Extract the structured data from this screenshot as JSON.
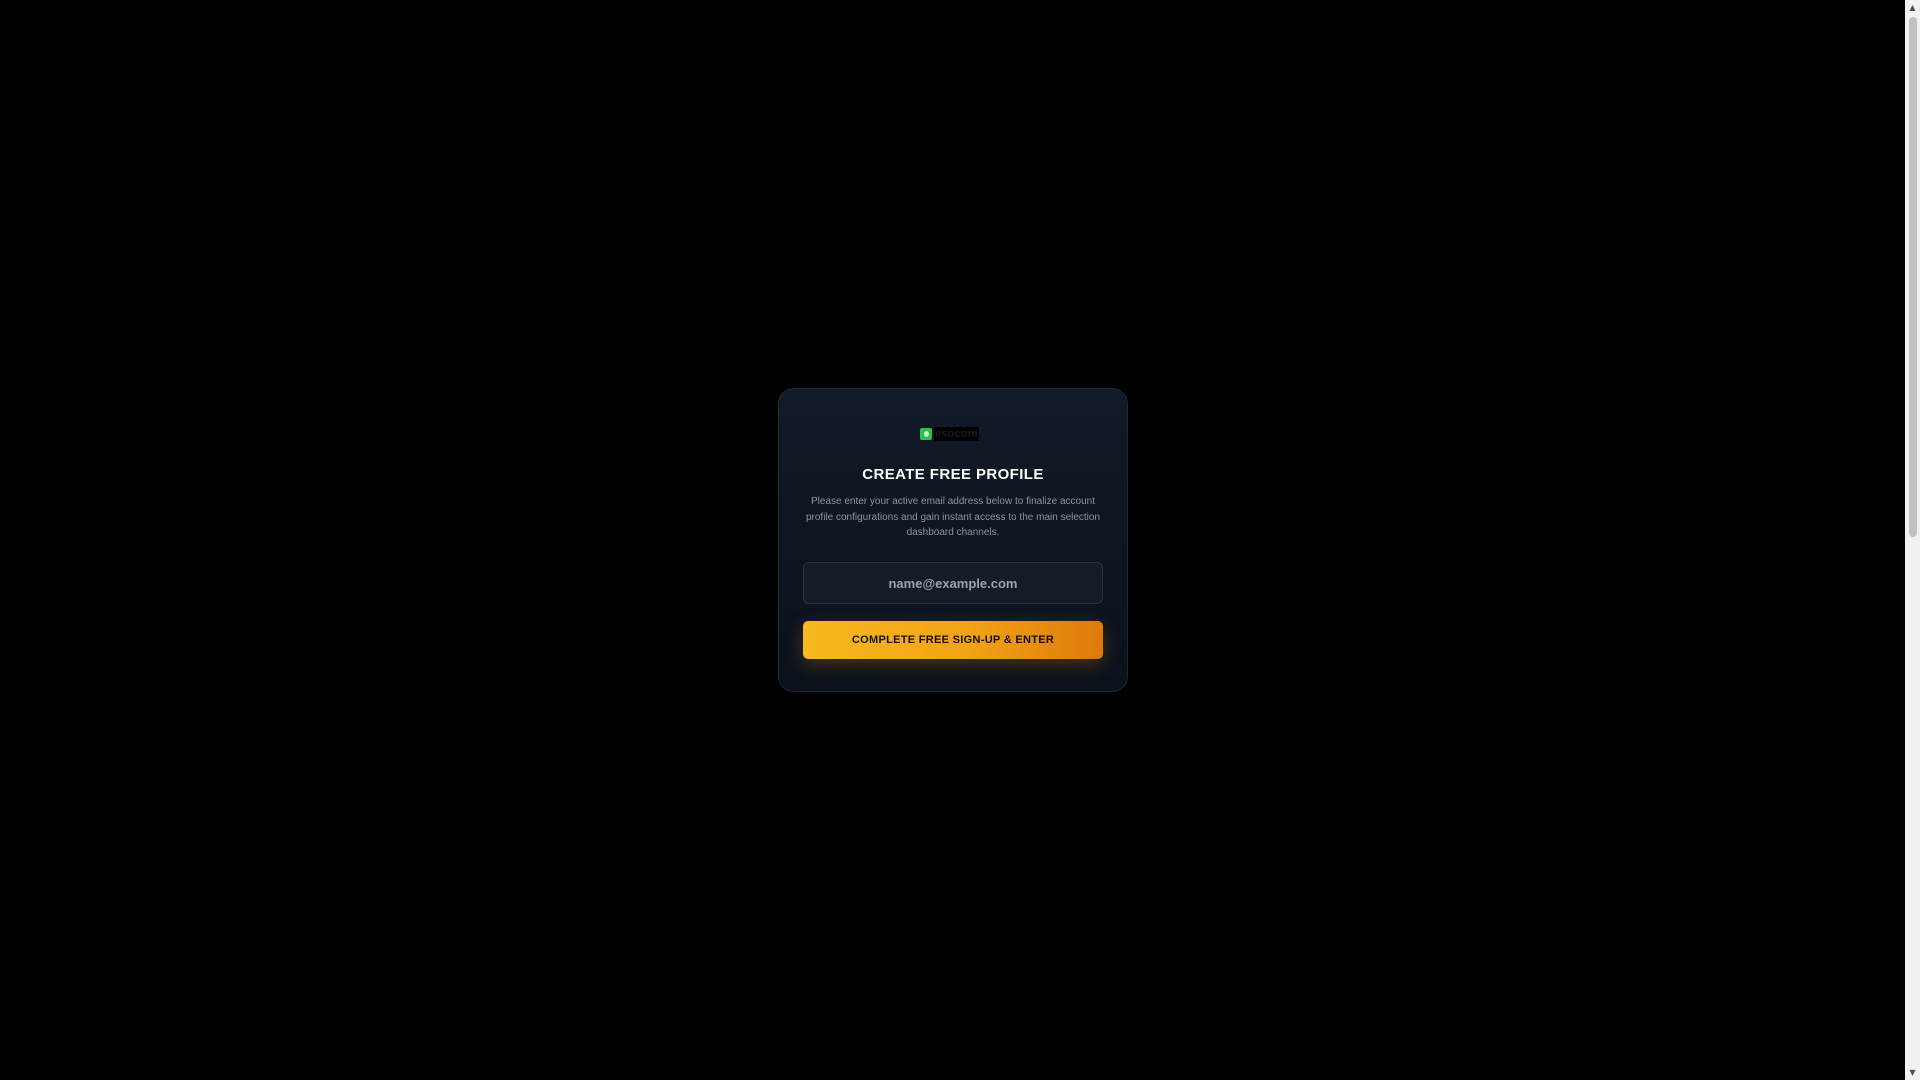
{
  "card": {
    "logo": {
      "icon": "brand-logo-icon",
      "text": "esocom"
    },
    "title": "CREATE FREE PROFILE",
    "subtitle": "Please enter your active email address below to finalize account profile configurations and gain instant access to the main selection dashboard channels.",
    "email": {
      "value": "",
      "placeholder": "name@example.com"
    },
    "submit_label": "COMPLETE FREE SIGN-UP & ENTER"
  },
  "colors": {
    "background": "#000000",
    "card": "#0f1723",
    "accent_start": "#f8b920",
    "accent_end": "#dd7a0a",
    "logo_green": "#2ebd4e"
  },
  "scrollbar": {
    "up_icon": "scroll-up-arrow-icon",
    "down_icon": "scroll-down-arrow-icon"
  }
}
